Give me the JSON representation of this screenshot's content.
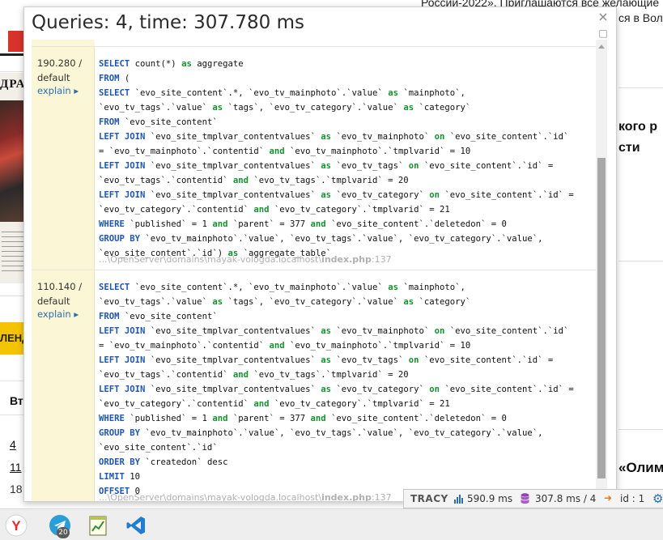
{
  "background_page": {
    "top_banner_text_1": "России-2022». Приглашаются все желающие",
    "top_banner_text_2": "ся в Воло",
    "calendar_header": "Вт",
    "calendar_days": [
      "4",
      "11",
      "18"
    ],
    "yellow_button_text": "ЛЕНД",
    "magazine_header": "ДРА",
    "right_heading_1": "кого р",
    "right_heading_2": "сти",
    "right_heading_3": "«Олим"
  },
  "panel": {
    "title": "Queries: 4, time: 307.780 ms",
    "close_glyph": "×",
    "maximize_glyph": "□",
    "queries": [
      {
        "time": "190.280 /",
        "connection": "default",
        "explain_label": "explain ▸",
        "sql_lines": [
          "SELECT count(*) as aggregate",
          "FROM (",
          "SELECT `evo_site_content`.*, `evo_tv_mainphoto`.`value` as `mainphoto`,",
          "`evo_tv_tags`.`value` as `tags`, `evo_tv_category`.`value` as `category`",
          "FROM `evo_site_content`",
          "LEFT JOIN `evo_site_tmplvar_contentvalues` as `evo_tv_mainphoto` on `evo_site_content`.`id`",
          "= `evo_tv_mainphoto`.`contentid` and `evo_tv_mainphoto`.`tmplvarid` = 10",
          "LEFT JOIN `evo_site_tmplvar_contentvalues` as `evo_tv_tags` on `evo_site_content`.`id` =",
          "`evo_tv_tags`.`contentid` and `evo_tv_tags`.`tmplvarid` = 20",
          "LEFT JOIN `evo_site_tmplvar_contentvalues` as `evo_tv_category` on `evo_site_content`.`id` =",
          "`evo_tv_category`.`contentid` and `evo_tv_category`.`tmplvarid` = 21",
          "WHERE `published` = 1 and `parent` = 377 and `evo_site_content`.`deletedon` = 0",
          "GROUP BY `evo_tv_mainphoto`.`value`, `evo_tv_tags`.`value`, `evo_tv_category`.`value`,",
          "`evo_site_content`.`id`) as `aggregate_table`"
        ],
        "source_path": "...\\OpenServer\\domains\\mayak-vologda.localhost\\",
        "source_file": "index.php",
        "source_line": ":137"
      },
      {
        "time": "110.140 /",
        "connection": "default",
        "explain_label": "explain ▸",
        "sql_lines": [
          "SELECT `evo_site_content`.*, `evo_tv_mainphoto`.`value` as `mainphoto`,",
          "`evo_tv_tags`.`value` as `tags`, `evo_tv_category`.`value` as `category`",
          "FROM `evo_site_content`",
          "LEFT JOIN `evo_site_tmplvar_contentvalues` as `evo_tv_mainphoto` on `evo_site_content`.`id`",
          "= `evo_tv_mainphoto`.`contentid` and `evo_tv_mainphoto`.`tmplvarid` = 10",
          "LEFT JOIN `evo_site_tmplvar_contentvalues` as `evo_tv_tags` on `evo_site_content`.`id` =",
          "`evo_tv_tags`.`contentid` and `evo_tv_tags`.`tmplvarid` = 20",
          "LEFT JOIN `evo_site_tmplvar_contentvalues` as `evo_tv_category` on `evo_site_content`.`id` =",
          "`evo_tv_category`.`contentid` and `evo_tv_category`.`tmplvarid` = 21",
          "WHERE `published` = 1 and `parent` = 377 and `evo_site_content`.`deletedon` = 0",
          "GROUP BY `evo_tv_mainphoto`.`value`, `evo_tv_tags`.`value`, `evo_tv_category`.`value`,",
          "`evo_site_content`.`id`",
          "ORDER BY `createdon` desc",
          "LIMIT 10",
          "OFFSET 0"
        ],
        "source_path": "...\\OpenServer\\domains\\mayak-vologda.localhost\\",
        "source_file": "index.php",
        "source_line": ":137"
      }
    ],
    "sql_keywords": [
      "SELECT",
      "FROM",
      "LEFT JOIN",
      "WHERE",
      "GROUP BY",
      "ORDER BY",
      "LIMIT",
      "OFFSET"
    ],
    "sql_operators": [
      "as",
      "on",
      "and"
    ]
  },
  "tracy_bar": {
    "logo": "TRACY",
    "time": "590.9 ms",
    "db": "307.8 ms / 4",
    "id": "id : 1",
    "icons": [
      "bar-chart-icon",
      "database-icon",
      "sign-in-icon",
      "gear-icon"
    ],
    "colors": {
      "time": "#2a6db3",
      "db": "#8e44ad",
      "id": "#e8741c",
      "gear": "#2a6db3"
    }
  },
  "taskbar": {
    "apps": [
      {
        "name": "yandex-browser",
        "letter": "Y"
      },
      {
        "name": "telegram",
        "badge": "20"
      },
      {
        "name": "notepad-chart"
      },
      {
        "name": "vscode"
      }
    ]
  }
}
